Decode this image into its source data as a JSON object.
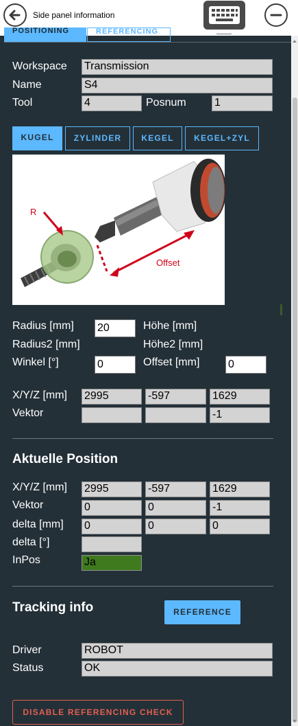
{
  "titlebar": {
    "title": "Side panel information",
    "back_icon": "back-arrow-icon",
    "keyboard_icon": "keyboard-icon",
    "minimize_icon": "minus-circle-icon"
  },
  "tabs": [
    {
      "label": "POSITIONING"
    },
    {
      "label": "REFERENCING"
    }
  ],
  "info": {
    "workspace_label": "Workspace",
    "workspace_value": "Transmission",
    "name_label": "Name",
    "name_value": "S4",
    "tool_label": "Tool",
    "tool_value": "4",
    "posnum_label": "Posnum",
    "posnum_value": "1"
  },
  "shapes": [
    {
      "label": "KUGEL",
      "active": true
    },
    {
      "label": "ZYLINDER"
    },
    {
      "label": "KEGEL"
    },
    {
      "label": "KEGEL+ZYL"
    }
  ],
  "illustration": {
    "r_label": "R",
    "offset_label": "Offset"
  },
  "params": {
    "radius_label": "Radius [mm]",
    "radius_value": "20",
    "hoehe_label": "Höhe [mm]",
    "radius2_label": "Radius2 [mm]",
    "hoehe2_label": "Höhe2 [mm]",
    "winkel_label": "Winkel [°]",
    "winkel_value": "0",
    "offset_label": "Offset [mm]",
    "offset_value": "0"
  },
  "target": {
    "xyz_label": "X/Y/Z [mm]",
    "xyz": [
      "2995",
      "-597",
      "1629"
    ],
    "vektor_label": "Vektor",
    "vektor": [
      "",
      "",
      "-1"
    ]
  },
  "current": {
    "header": "Aktuelle Position",
    "xyz_label": "X/Y/Z [mm]",
    "xyz": [
      "2995",
      "-597",
      "1629"
    ],
    "vektor_label": "Vektor",
    "vektor": [
      "0",
      "0",
      "-1"
    ],
    "delta_mm_label": "delta [mm]",
    "delta_mm": [
      "0",
      "0",
      "0"
    ],
    "delta_deg_label": "delta [°]",
    "delta_deg": "",
    "inpos_label": "InPos",
    "inpos_value": "Ja",
    "inpos_color": "#3f7a1f"
  },
  "tracking": {
    "header": "Tracking info",
    "reference_button": "REFERENCE",
    "driver_label": "Driver",
    "driver_value": "ROBOT",
    "status_label": "Status",
    "status_value": "OK"
  },
  "footer": {
    "disable_button": "DISABLE REFERENCING CHECK"
  },
  "colors": {
    "background": "#243038",
    "accent": "#5cb8ff",
    "danger": "#e2604f",
    "field": "#d3d3d3"
  }
}
